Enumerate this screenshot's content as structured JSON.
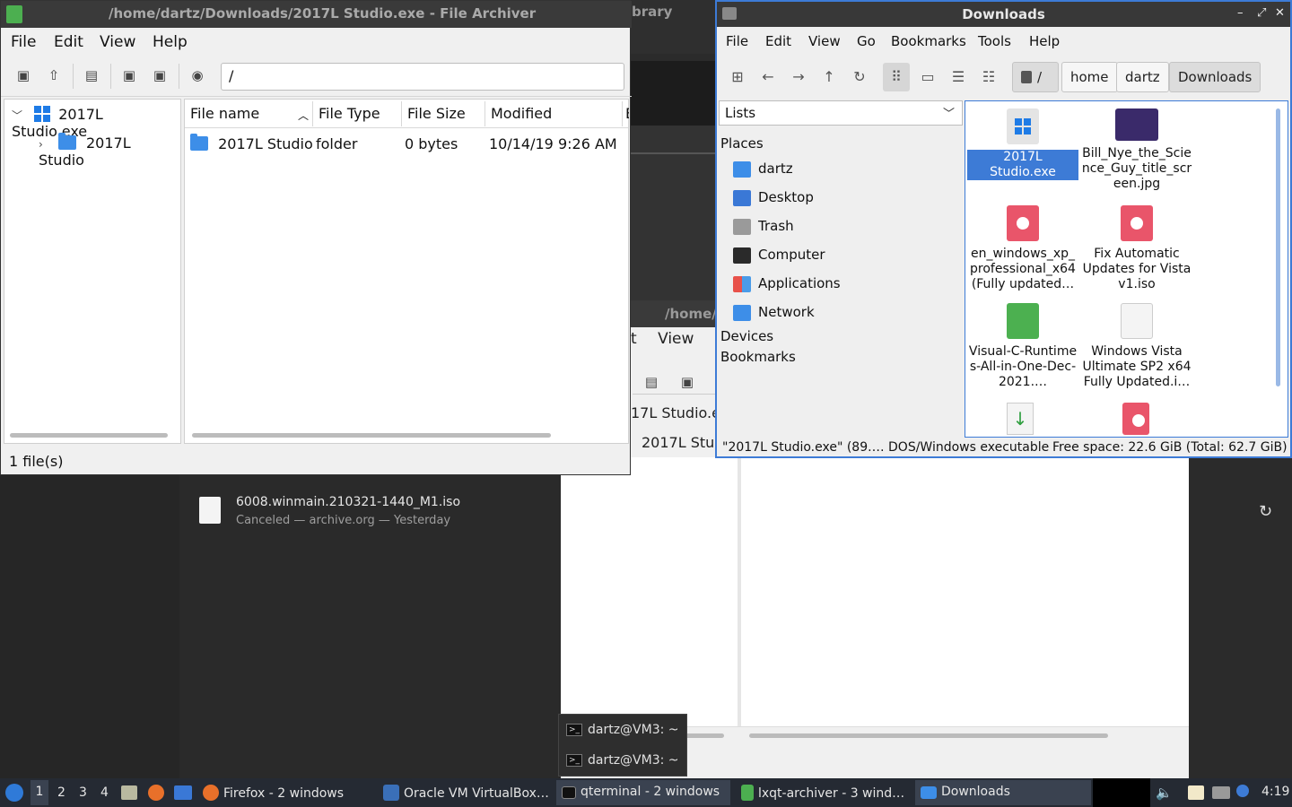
{
  "background": {
    "library_title_fragment": "brary",
    "download_item": {
      "name": "6008.winmain.210321-1440_M1.iso",
      "status": "Canceled — archive.org — Yesterday"
    },
    "second_archiver": {
      "title_fragment": "/home/",
      "menu_view": "View",
      "menu_edit_fragment": "t",
      "row1_fragment": "17L Studio.e",
      "row2_fragment": "2017L Stud"
    },
    "terminal_popup": [
      "dartz@VM3: ~",
      "dartz@VM3: ~"
    ]
  },
  "archiver": {
    "title": "/home/dartz/Downloads/2017L Studio.exe - File Archiver",
    "menu": [
      "File",
      "Edit",
      "View",
      "Help"
    ],
    "path": "/",
    "tree": [
      {
        "label": "2017L Studio.exe",
        "expanded": true
      },
      {
        "label": "2017L Studio",
        "expanded": false
      }
    ],
    "columns": [
      "File name",
      "File Type",
      "File Size",
      "Modified",
      "E"
    ],
    "rows": [
      {
        "name": "2017L Studio",
        "type": "folder",
        "size": "0 bytes",
        "modified": "10/14/19 9:26 AM"
      }
    ],
    "status": "1 file(s)"
  },
  "filemanager": {
    "title": "Downloads",
    "menu": [
      "File",
      "Edit",
      "View",
      "Go",
      "Bookmarks",
      "Tools",
      "Help"
    ],
    "breadcrumb": [
      "/",
      "home",
      "dartz",
      "Downloads"
    ],
    "side_mode": "Lists",
    "places_header": "Places",
    "places": [
      "dartz",
      "Desktop",
      "Trash",
      "Computer",
      "Applications",
      "Network"
    ],
    "devices_header": "Devices",
    "bookmarks_header": "Bookmarks",
    "files": [
      {
        "name": "2017L Studio.exe",
        "selected": true,
        "icon": "windows-logo-icon"
      },
      {
        "name": "Bill_Nye_the_Science_Guy_title_screen.jpg",
        "icon": "image-thumbnail-icon"
      },
      {
        "name": "en_windows_xp_professional_x64 (Fully updated…",
        "icon": "disc-image-icon"
      },
      {
        "name": "Fix Automatic Updates for Vista v1.iso",
        "icon": "disc-image-icon"
      },
      {
        "name": "Visual-C-Runtimes-All-in-One-Dec-2021.…",
        "icon": "zip-archive-icon"
      },
      {
        "name": "Windows Vista Ultimate SP2 x64 Fully Updated.i…",
        "icon": "text-document-icon"
      }
    ],
    "status": "\"2017L Studio.exe\" (89.… DOS/Windows executable",
    "free_space": "Free space: 22.6 GiB (Total: 62.7 GiB)"
  },
  "taskbar": {
    "desktops": [
      "1",
      "2",
      "3",
      "4"
    ],
    "tasks": [
      "Firefox - 2 windows",
      "Oracle VM VirtualBox…",
      "qterminal - 2 windows",
      "lxqt-archiver - 3 wind…",
      "Downloads"
    ],
    "clock": "4:19"
  },
  "colors": {
    "accent": "#3d7bd6",
    "taskbar": "#252a33",
    "titlebar": "#3a3a3a"
  }
}
